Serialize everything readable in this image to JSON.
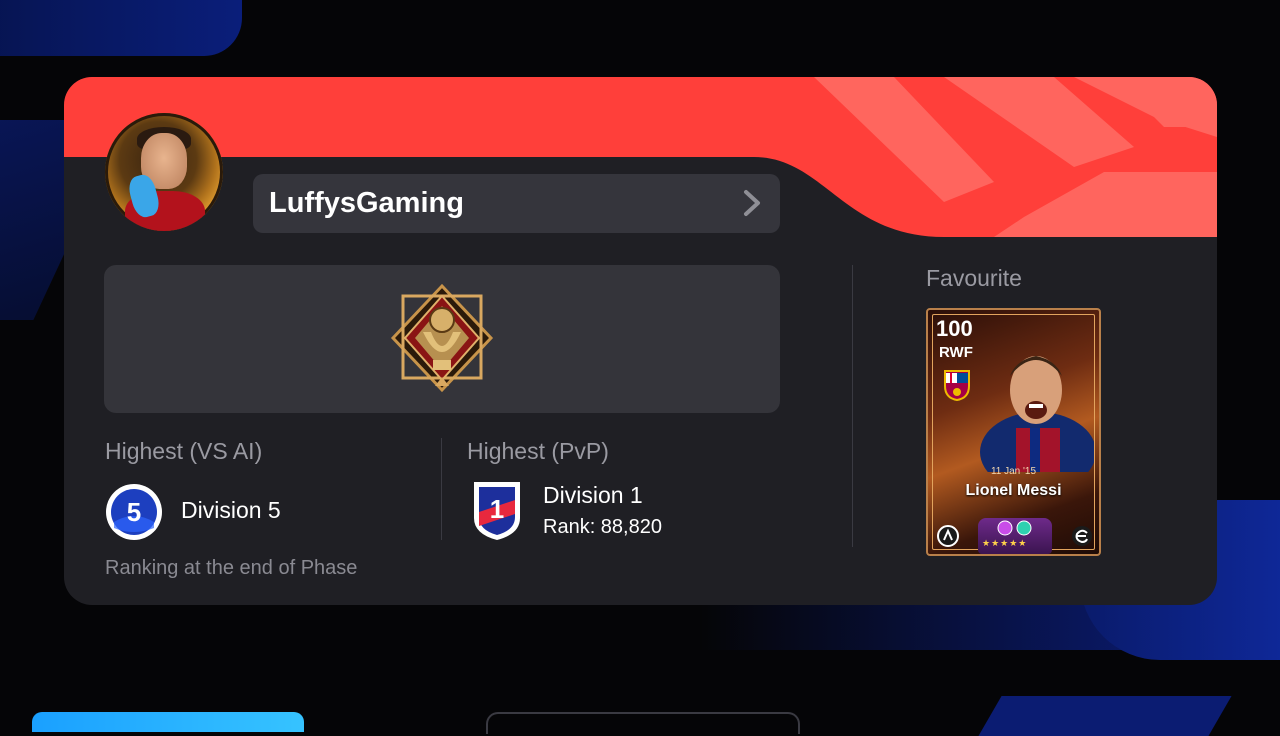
{
  "profile": {
    "username": "LuffysGaming"
  },
  "stats": {
    "vs_ai": {
      "label": "Highest (VS AI)",
      "division": "Division 5",
      "badge_number": "5",
      "note": "Ranking at the end of Phase"
    },
    "pvp": {
      "label": "Highest (PvP)",
      "division": "Division 1",
      "badge_number": "1",
      "rank": "Rank: 88,820"
    }
  },
  "favourite": {
    "label": "Favourite",
    "card": {
      "rating": "100",
      "position": "RWF",
      "date": "11 Jan '15",
      "player_name": "Lionel Messi",
      "stars": "★★★★★"
    }
  },
  "colors": {
    "accent_red": "#ff3f3a",
    "card_bg": "#1f1f24",
    "panel_bg": "#34343a",
    "muted_text": "#9a9aa2",
    "badge_blue": "#1d3fbf"
  },
  "icons": {
    "chevron": "chevron-right-icon",
    "rank_emblem": "trophy-emblem-icon",
    "team_crest": "team-crest-icon"
  }
}
